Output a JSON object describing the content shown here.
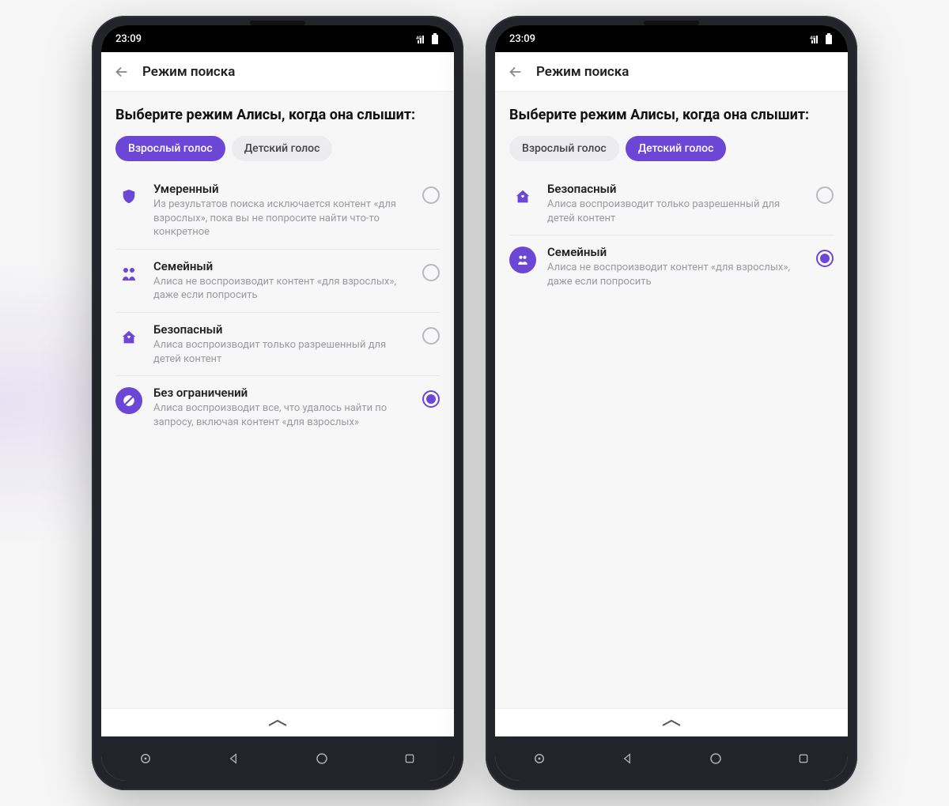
{
  "statusbar": {
    "time": "23:09",
    "net_label": "4G"
  },
  "header": {
    "title": "Режим поиска"
  },
  "heading": "Выберите режим Алисы, когда она слышит:",
  "tabs": {
    "adult": "Взрослый голос",
    "child": "Детский голос"
  },
  "left": {
    "active_tab": "adult",
    "options": [
      {
        "icon": "shield-icon",
        "icon_style": "plain",
        "title": "Умеренный",
        "desc": "Из результатов поиска исключается контент «для взрослых», пока вы не попросите найти что-то конкретное",
        "selected": false
      },
      {
        "icon": "family-icon",
        "icon_style": "plain",
        "title": "Семейный",
        "desc": "Алиса не воспроизводит контент «для взрослых», даже если попросить",
        "selected": false
      },
      {
        "icon": "home-icon",
        "icon_style": "plain",
        "title": "Безопасный",
        "desc": "Алиса воспроизводит только разрешенный для детей контент",
        "selected": false
      },
      {
        "icon": "unlimited-icon",
        "icon_style": "circle",
        "title": "Без ограничений",
        "desc": "Алиса воспроизводит все, что удалось найти по запросу, включая контент «для взрослых»",
        "selected": true
      }
    ]
  },
  "right": {
    "active_tab": "child",
    "options": [
      {
        "icon": "home-icon",
        "icon_style": "plain",
        "title": "Безопасный",
        "desc": "Алиса воспроизводит только разрешенный для детей контент",
        "selected": false
      },
      {
        "icon": "family-icon",
        "icon_style": "circle",
        "title": "Семейный",
        "desc": "Алиса не воспроизводит контент «для взрослых», даже если попросить",
        "selected": true
      }
    ]
  },
  "icons": {
    "shield-icon": "shield",
    "family-icon": "family",
    "home-icon": "home",
    "unlimited-icon": "unlimited"
  },
  "colors": {
    "accent": "#6c47d6"
  }
}
